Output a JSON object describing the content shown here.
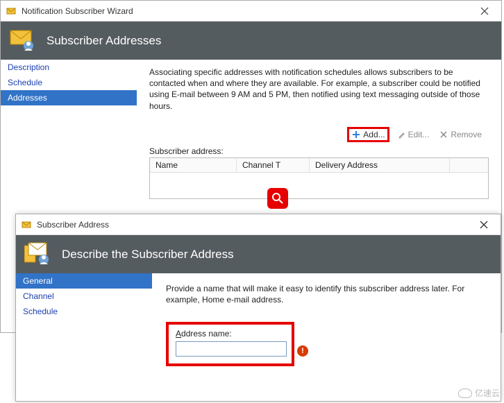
{
  "window1": {
    "title": "Notification Subscriber Wizard",
    "banner": "Subscriber Addresses",
    "sidebar": {
      "items": [
        "Description",
        "Schedule",
        "Addresses"
      ],
      "selected": 2
    },
    "desc": "Associating specific addresses with notification schedules allows subscribers to be contacted when and where they are available. For example, a subscriber could be notified using E-mail between 9 AM and 5 PM, then notified using text messaging outside of those hours.",
    "toolbar": {
      "add": "Add...",
      "edit": "Edit...",
      "remove": "Remove"
    },
    "table": {
      "label": "Subscriber address:",
      "headers": {
        "name": "Name",
        "channel": "Channel T",
        "delivery": "Delivery Address"
      }
    }
  },
  "window2": {
    "title": "Subscriber Address",
    "banner": "Describe the Subscriber Address",
    "sidebar": {
      "items": [
        "General",
        "Channel",
        "Schedule"
      ],
      "selected": 0
    },
    "desc": "Provide a name that will make it easy to identify this subscriber address later. For example, Home e-mail address.",
    "field": {
      "label": "Address name:",
      "value": "",
      "placeholder": ""
    }
  },
  "watermark": "亿速云"
}
